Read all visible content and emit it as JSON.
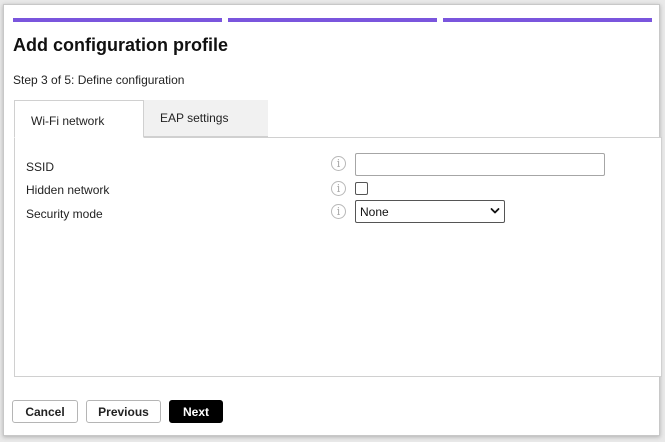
{
  "colors": {
    "progress": "#7a55dd",
    "primary_button": "#000000"
  },
  "progress": {
    "current_step": 3,
    "total_steps": 5
  },
  "header": {
    "title": "Add configuration profile",
    "step_label": "Step 3 of 5: Define configuration"
  },
  "tabs": [
    {
      "label": "Wi-Fi network",
      "active": true
    },
    {
      "label": "EAP settings",
      "active": false
    }
  ],
  "form": {
    "ssid": {
      "label": "SSID",
      "value": "",
      "icon": "info-icon"
    },
    "hidden_network": {
      "label": "Hidden network",
      "checked": false,
      "icon": "info-icon"
    },
    "security_mode": {
      "label": "Security mode",
      "value": "None",
      "icon": "info-icon"
    }
  },
  "footer": {
    "cancel_label": "Cancel",
    "previous_label": "Previous",
    "next_label": "Next"
  }
}
